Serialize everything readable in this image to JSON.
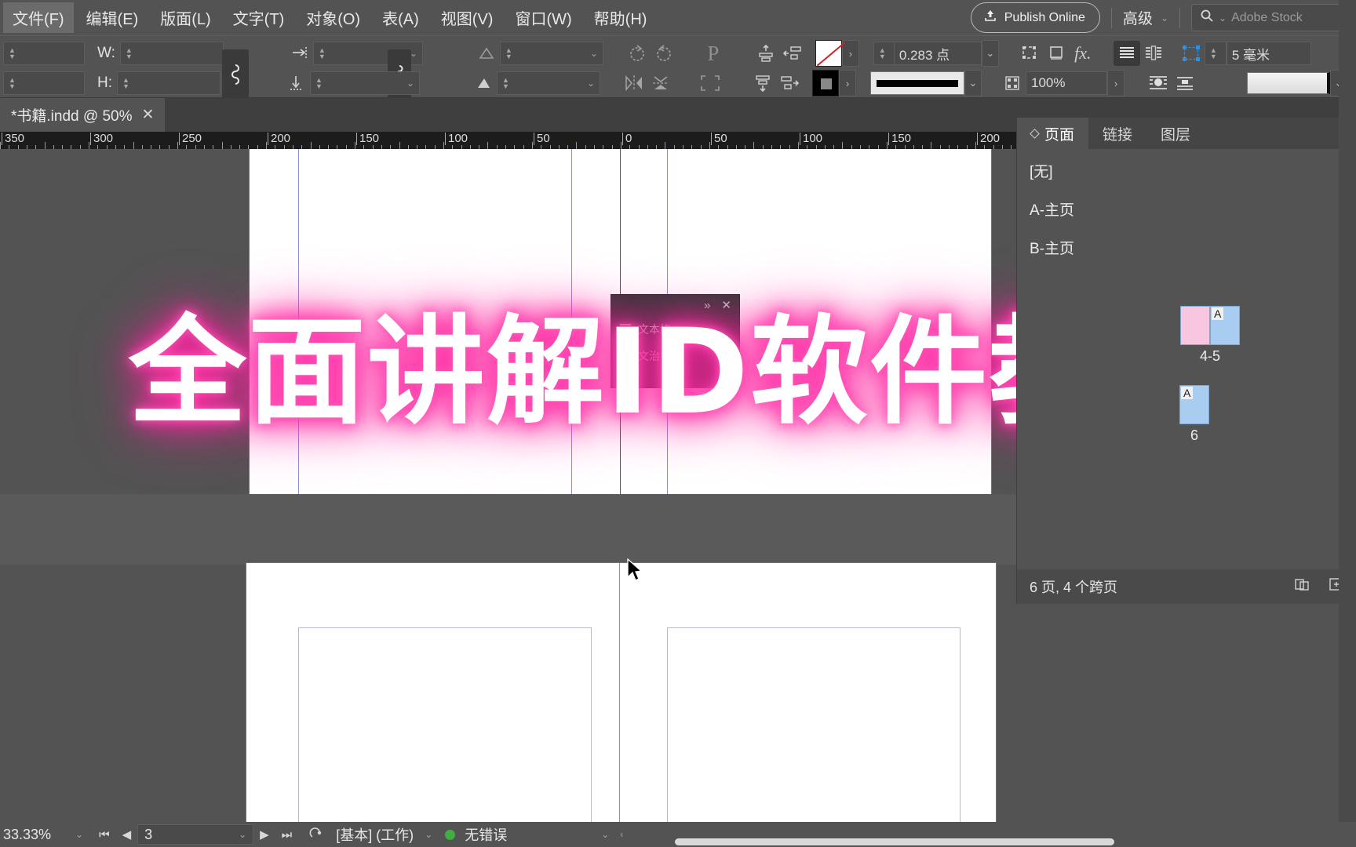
{
  "app": {
    "menu": [
      {
        "label": "文件(F)",
        "mn": "F",
        "active": true
      },
      {
        "label": "编辑(E)",
        "mn": "E",
        "active": false
      },
      {
        "label": "版面(L)",
        "mn": "L",
        "active": false
      },
      {
        "label": "文字(T)",
        "mn": "T",
        "active": false
      },
      {
        "label": "对象(O)",
        "mn": "O",
        "active": false
      },
      {
        "label": "表(A)",
        "mn": "A",
        "active": false
      },
      {
        "label": "视图(V)",
        "mn": "V",
        "active": false
      },
      {
        "label": "窗口(W)",
        "mn": "W",
        "active": false
      },
      {
        "label": "帮助(H)",
        "mn": "H",
        "active": false
      }
    ],
    "publish_label": "Publish Online",
    "workspace_label": "高级",
    "stock_placeholder": "Adobe Stock",
    "accent_color": "#ff1f9e",
    "chrome_color": "#535353"
  },
  "control_bar": {
    "w_label": "W:",
    "h_label": "H:",
    "w_value": "",
    "h_value": "",
    "x_value": "",
    "y_value": "",
    "rotate_value": "",
    "shear_value": "",
    "stroke_weight": "0.283 点",
    "opacity": "100%",
    "gap_value": "5 毫米",
    "constrain_icon": "link-icon",
    "p_icon": "P",
    "fx_label": "fx."
  },
  "doc_tab": {
    "title": "*书籍.indd @ 50%",
    "close": "✕"
  },
  "ruler": {
    "unit": "mm",
    "labels": [
      "350",
      "300",
      "250",
      "200",
      "150",
      "100",
      "50",
      "0",
      "50",
      "100",
      "150",
      "200"
    ]
  },
  "mini_panel": {
    "collapse": "»",
    "close": "✕",
    "rows": [
      "文本绕",
      "文治框"
    ]
  },
  "overlay": {
    "text": "全面讲解ID软件教程"
  },
  "pages_panel": {
    "tabs": [
      {
        "label": "页面",
        "active": true
      },
      {
        "label": "链接",
        "active": false
      },
      {
        "label": "图层",
        "active": false
      }
    ],
    "masters": [
      "[无]",
      "A-主页",
      "B-主页"
    ],
    "thumbnails": [
      {
        "label": "4-5",
        "master": "A",
        "pages": 2
      },
      {
        "label": "6",
        "master": "A",
        "pages": 1
      }
    ],
    "footer_count": "6 页, 4 个跨页",
    "footer_icons": [
      "new-master-icon",
      "new-page-icon",
      "delete-page-icon"
    ]
  },
  "status_bar": {
    "zoom": "33.33%",
    "page_number": "3",
    "preflight_profile": "[基本] (工作)",
    "error_status": "无错误",
    "first_icon": "⏮",
    "prev_icon": "◀",
    "next_icon": "▶",
    "last_icon": "⏭"
  }
}
